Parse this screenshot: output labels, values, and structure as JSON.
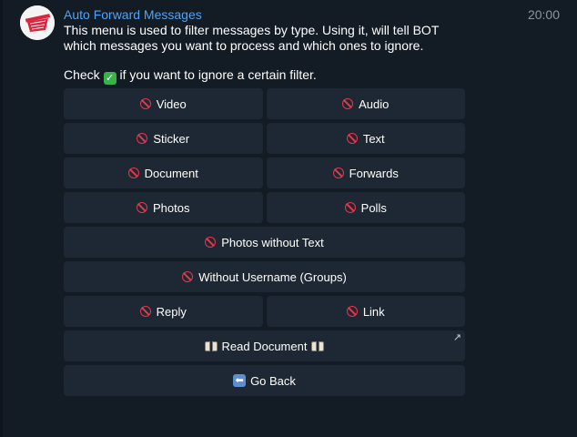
{
  "chat": {
    "bot_name": "Auto Forward Messages",
    "time": "20:00"
  },
  "message": {
    "line1": "This menu is used to filter messages by type. Using it, will tell BOT which messages you want to process and which ones to ignore.",
    "check_prefix": "Check ",
    "check_suffix": " if you want to ignore a certain filter."
  },
  "keyboard": {
    "video": "Video",
    "audio": "Audio",
    "sticker": "Sticker",
    "text": "Text",
    "document": "Document",
    "forwards": "Forwards",
    "photos": "Photos",
    "polls": "Polls",
    "photos_without_text": "Photos without Text",
    "without_username": "Without Username (Groups)",
    "reply": "Reply",
    "link": "Link",
    "read_document": "Read Document",
    "go_back": "Go Back"
  },
  "icons": {
    "filter_status": "no-entry-icon",
    "check": "check-mark-button-icon",
    "read_document": "open-book-icon",
    "go_back": "back-arrow-icon",
    "url_button": "external-link-arrow-icon"
  },
  "colors": {
    "background": "#131b25",
    "button_bg": "#1e2834",
    "bot_name": "#4ea4f6",
    "timestamp": "#8a96a3",
    "no_entry": "#e8364b",
    "check": "#37b34a"
  }
}
